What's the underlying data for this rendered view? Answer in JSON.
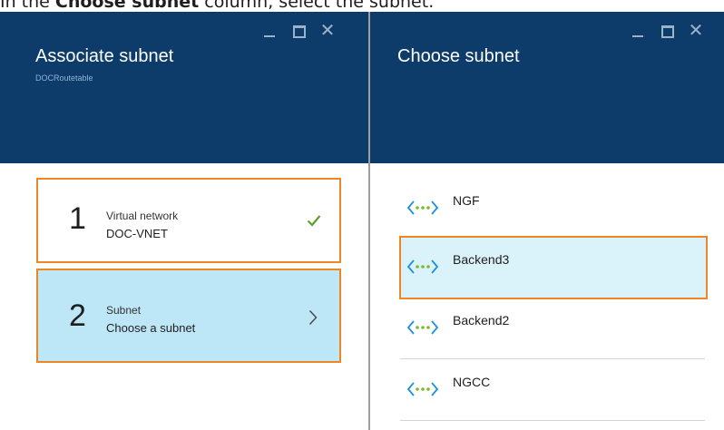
{
  "caption": {
    "prefix": "In the ",
    "bold": "Choose subnet",
    "suffix": " column, select the subnet."
  },
  "left_pane": {
    "title": "Associate subnet",
    "subtitle": "DOCRoutetable",
    "steps": [
      {
        "number": "1",
        "label": "Virtual network",
        "value": "DOC-VNET",
        "status": "complete"
      },
      {
        "number": "2",
        "label": "Subnet",
        "value": "Choose a subnet",
        "status": "active"
      }
    ]
  },
  "right_pane": {
    "title": "Choose subnet",
    "subnets": [
      {
        "name": "NGF"
      },
      {
        "name": "Backend3",
        "selected": true
      },
      {
        "name": "Backend2"
      },
      {
        "name": "NGCC"
      }
    ]
  },
  "window_controls": {
    "close_glyph": "✕"
  },
  "colors": {
    "header_bg": "#0d3c6b",
    "highlight_border": "#f08523",
    "selected_step_bg": "#bde7f7",
    "selected_item_bg": "#daf3fb",
    "check": "#5fa02b",
    "network_icon": "#1e90d6",
    "network_dots": "#7dbb2e"
  },
  "icons": {
    "step_complete": "checkmark-icon",
    "step_active": "chevron-right-icon",
    "subnet": "network-subnet-icon"
  }
}
